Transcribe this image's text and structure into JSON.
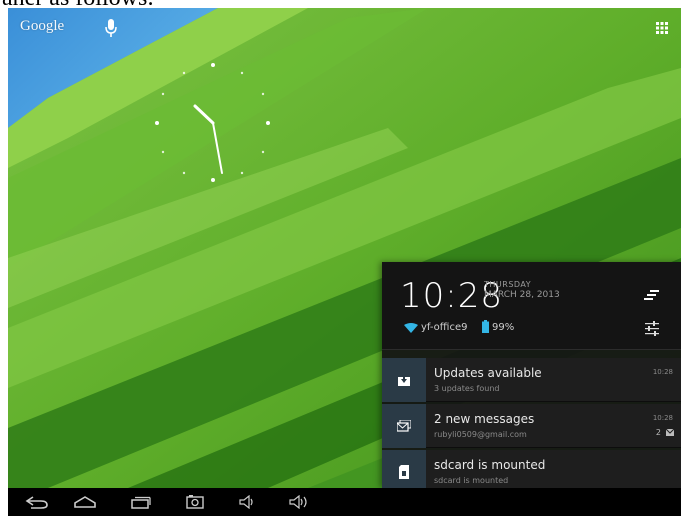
{
  "doc": {
    "top_text": "aner as follows:"
  },
  "home": {
    "google_label": "Google",
    "icons": {
      "mic": "microphone-icon",
      "apps": "all-apps-grid-icon"
    }
  },
  "clock_widget": {
    "type": "analog-clock",
    "time": "10:28"
  },
  "notification_panel": {
    "time": "10:28",
    "day": "THURSDAY",
    "date": "MARCH 28, 2013",
    "wifi_name": "yf-office9",
    "battery": "99%",
    "icons": {
      "toggle": "notification-toggle-icon",
      "settings": "quick-settings-icon",
      "wifi": "wifi-icon",
      "battery": "battery-icon"
    },
    "notifications": [
      {
        "title": "Updates available",
        "subtitle": "3 updates found",
        "time": "10:28",
        "count": "",
        "icon": "update-download-icon"
      },
      {
        "title": "2 new messages",
        "subtitle": "rubyli0509@gmail.com",
        "time": "10:28",
        "count": "2",
        "icon": "email-icon"
      },
      {
        "title": "sdcard is mounted",
        "subtitle": "sdcard is mounted",
        "time": "",
        "count": "",
        "icon": "sdcard-icon"
      }
    ]
  },
  "navbar": {
    "buttons": [
      "back-icon",
      "home-icon",
      "recent-apps-icon",
      "screenshot-icon",
      "volume-down-icon",
      "volume-up-icon"
    ]
  },
  "colors": {
    "wallpaper_green": "#5fae2a",
    "wifi_blue": "#33b5e5",
    "panel_bg": "#141414",
    "icon_box": "#2a3a46"
  }
}
